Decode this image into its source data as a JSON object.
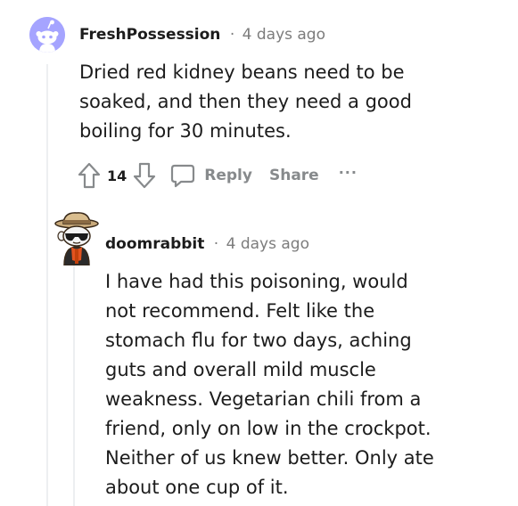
{
  "comments": [
    {
      "username": "FreshPossession",
      "separator": "·",
      "time": "4 days ago",
      "avatar_icon": "snoo-default-avatar-icon",
      "body": "Dried red kidney beans need to be soaked, and then they need a good boiling for 30 minutes.",
      "votes": "14",
      "reply_label": "Reply",
      "share_label": "Share",
      "more_label": "···"
    },
    {
      "username": "doomrabbit",
      "separator": "·",
      "time": "4 days ago",
      "avatar_icon": "explorer-hat-sunglasses-avatar-icon",
      "body": "I have had this poisoning, would not recommend. Felt like the stomach flu for two days, aching guts and overall mild muscle weakness. Vegetarian chili from a friend, only on low in the crockpot. Neither of us knew better. Only ate about one cup of it."
    }
  ],
  "colors": {
    "text": "#1c1c1c",
    "meta": "#7c7c7c",
    "action": "#878a8c",
    "thread_line": "#edeff1",
    "avatar_bg": "#a5a4ff"
  }
}
